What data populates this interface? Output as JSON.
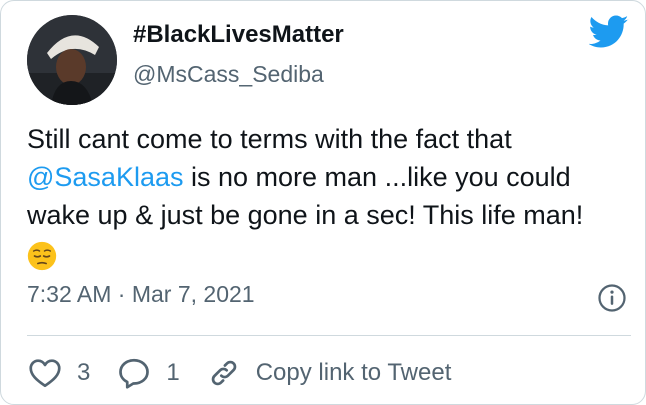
{
  "tweet": {
    "display_name": "#BlackLivesMatter",
    "handle": "@MsCass_Sediba",
    "text_before": "Still cant come to terms with the fact that ",
    "mention": "@SasaKlaas",
    "text_after": " is no more man ...like you could wake up & just be gone in a sec! This life man!",
    "timestamp": "7:32 AM · Mar 7, 2021"
  },
  "actions": {
    "like_count": "3",
    "reply_count": "1",
    "copy_link_label": "Copy link to Tweet"
  },
  "icons": {
    "brand": "twitter-bird-icon",
    "emoji": "pensive-face-emoji",
    "info": "info-icon",
    "like": "heart-icon",
    "reply": "comment-icon",
    "link": "link-icon"
  },
  "colors": {
    "brand_blue": "#1d9bf0",
    "text_primary": "#0f1419",
    "text_secondary": "#536471",
    "divider": "#cfd9de"
  }
}
